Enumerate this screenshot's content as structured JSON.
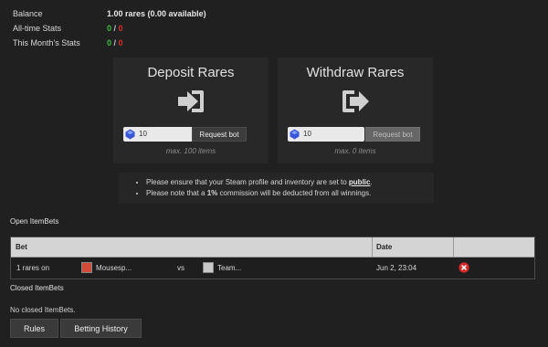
{
  "stats": {
    "balance_label": "Balance",
    "balance_value": "1.00 rares (0.00 available)",
    "alltime_label": "All-time Stats",
    "alltime_win": "0",
    "alltime_sep": " / ",
    "alltime_loss": "0",
    "month_label": "This Month's Stats",
    "month_win": "0",
    "month_sep": " / ",
    "month_loss": "0"
  },
  "deposit": {
    "title": "Deposit Rares",
    "amount": "10",
    "button": "Request bot",
    "note": "max. 100 items"
  },
  "withdraw": {
    "title": "Withdraw Rares",
    "amount": "10",
    "button": "Request bot",
    "note": "max. 0 items"
  },
  "notice": {
    "line1_prefix": "Please ensure that your Steam profile and inventory are set to ",
    "line1_link": "public",
    "line1_suffix": ".",
    "line2_prefix": "Please note that a ",
    "line2_bold": "1%",
    "line2_suffix": " commission will be deducted from all winnings."
  },
  "open_bets": {
    "title": "Open ItemBets",
    "columns": [
      "Bet",
      "Date"
    ],
    "rows": [
      {
        "amount": "1 rares on",
        "team1": "Mousesp...",
        "vs": "vs",
        "team2": "Team...",
        "date": "Jun 2, 23:04"
      }
    ]
  },
  "closed_bets": {
    "title": "Closed ItemBets",
    "empty": "No closed ItemBets."
  },
  "buttons": {
    "rules": "Rules",
    "history": "Betting History"
  },
  "colors": {
    "win": "#3db83d",
    "loss": "#d22d2d",
    "delete": "#d42828"
  }
}
